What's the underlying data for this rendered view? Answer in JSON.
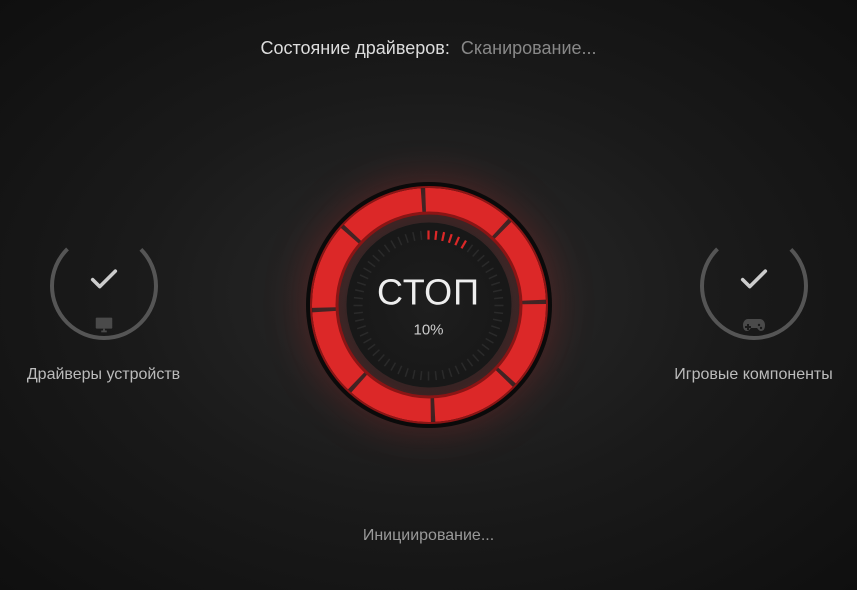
{
  "header": {
    "label": "Состояние драйверов:",
    "value": "Сканирование..."
  },
  "left": {
    "label": "Драйверы устройств"
  },
  "center": {
    "stop_label": "СТОП",
    "percent": "10%",
    "progress_value": 10
  },
  "right": {
    "label": "Игровые компоненты"
  },
  "footer": {
    "text": "Инициирование..."
  },
  "colors": {
    "accent": "#dc2828",
    "accent_dark": "#a01818"
  }
}
